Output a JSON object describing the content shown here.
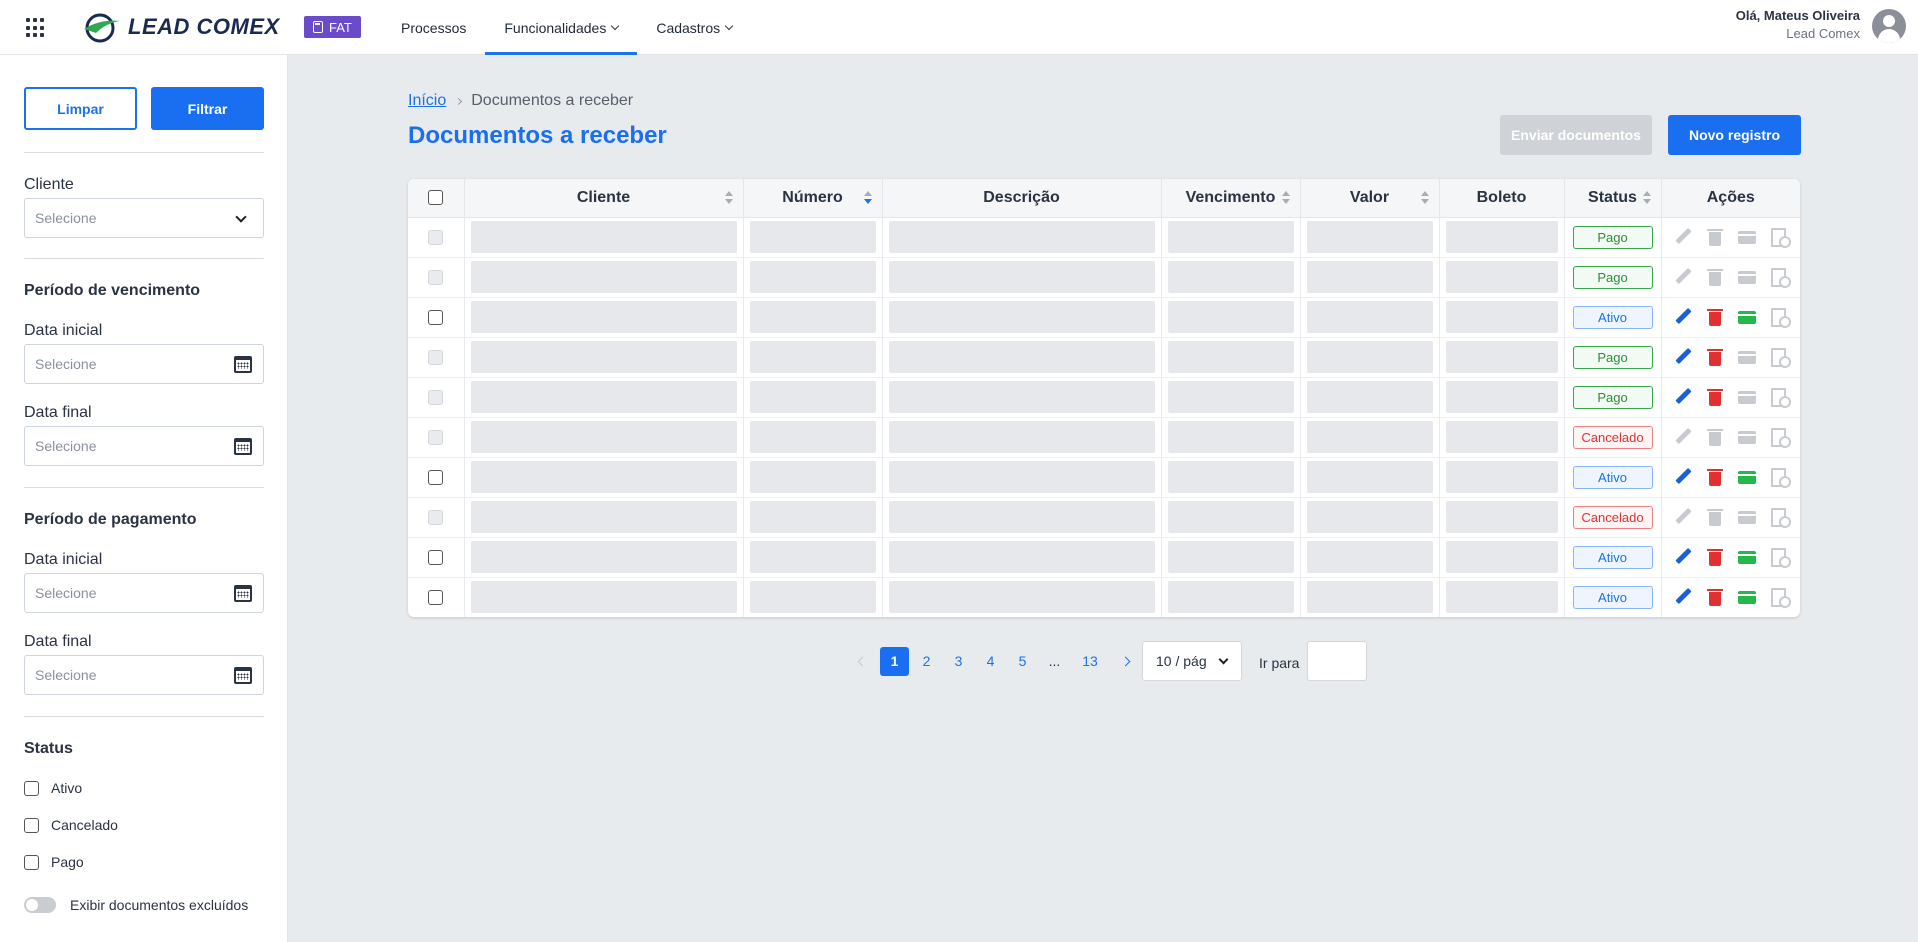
{
  "header": {
    "logo_text": "LEAD COMEX",
    "module_badge": "FAT",
    "nav": [
      {
        "label": "Processos"
      },
      {
        "label": "Funcionalidades"
      },
      {
        "label": "Cadastros"
      }
    ],
    "active_nav": "Funcionalidades",
    "user_greeting": "Olá, Mateus Oliveira",
    "user_company": "Lead Comex"
  },
  "sidebar": {
    "clear_label": "Limpar",
    "filter_label": "Filtrar",
    "client_label": "Cliente",
    "client_placeholder": "Selecione",
    "due_period_title": "Período de vencimento",
    "due_start_label": "Data inicial",
    "due_start_placeholder": "Selecione",
    "due_end_label": "Data final",
    "due_end_placeholder": "Selecione",
    "payment_period_title": "Período de pagamento",
    "pay_start_label": "Data inicial",
    "pay_start_placeholder": "Selecione",
    "pay_end_label": "Data final",
    "pay_end_placeholder": "Selecione",
    "status_title": "Status",
    "status_options": [
      "Ativo",
      "Cancelado",
      "Pago"
    ],
    "show_deleted_label": "Exibir documentos excluídos"
  },
  "breadcrumb": {
    "home": "Início",
    "current": "Documentos a receber"
  },
  "page_title": "Documentos a receber",
  "buttons": {
    "send_documents": "Enviar documentos",
    "new_record": "Novo registro"
  },
  "table": {
    "columns": [
      "Cliente",
      "Número",
      "Descrição",
      "Vencimento",
      "Valor",
      "Boleto",
      "Status",
      "Ações"
    ],
    "rows": [
      {
        "status": "Pago",
        "selectable": false,
        "edit": false,
        "delete": false,
        "boleto": false
      },
      {
        "status": "Pago",
        "selectable": false,
        "edit": false,
        "delete": false,
        "boleto": false
      },
      {
        "status": "Ativo",
        "selectable": true,
        "edit": true,
        "delete": true,
        "boleto": true
      },
      {
        "status": "Pago",
        "selectable": false,
        "edit": true,
        "delete": true,
        "boleto": false
      },
      {
        "status": "Pago",
        "selectable": false,
        "edit": true,
        "delete": true,
        "boleto": false
      },
      {
        "status": "Cancelado",
        "selectable": false,
        "edit": false,
        "delete": false,
        "boleto": false
      },
      {
        "status": "Ativo",
        "selectable": true,
        "edit": true,
        "delete": true,
        "boleto": true
      },
      {
        "status": "Cancelado",
        "selectable": false,
        "edit": false,
        "delete": false,
        "boleto": false
      },
      {
        "status": "Ativo",
        "selectable": true,
        "edit": true,
        "delete": true,
        "boleto": true
      },
      {
        "status": "Ativo",
        "selectable": true,
        "edit": true,
        "delete": true,
        "boleto": true
      }
    ]
  },
  "pagination": {
    "pages": [
      "1",
      "2",
      "3",
      "4",
      "5",
      "...",
      "13"
    ],
    "current": "1",
    "page_size": "10 / pág",
    "goto_label": "Ir para"
  },
  "colors": {
    "primary": "#1a6ff0",
    "badge_purple": "#6a4bc9",
    "status_pago": "#2e8b3d",
    "status_ativo": "#1a73e8",
    "status_cancelado": "#e03131"
  }
}
